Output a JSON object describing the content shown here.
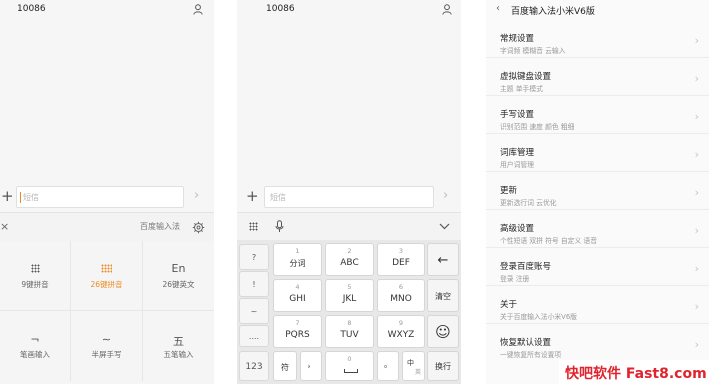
{
  "panel1": {
    "contact": "10086",
    "input_placeholder": "短信",
    "plus": "+",
    "send": "›",
    "close": "×",
    "ime_name": "百度输入法",
    "modes": [
      {
        "label": "9键拼音",
        "icon": "dot-grid-icon"
      },
      {
        "label": "26键拼音",
        "icon": "dot-grid-orange-icon"
      },
      {
        "label": "26键英文",
        "glyph": "En"
      },
      {
        "label": "笔画输入",
        "glyph": "¬"
      },
      {
        "label": "半屏手写",
        "glyph": "∼"
      },
      {
        "label": "五笔输入",
        "glyph": "五"
      }
    ]
  },
  "panel2": {
    "contact": "10086",
    "input_placeholder": "短信",
    "plus": "+",
    "send": "›",
    "left_keys": [
      "?",
      "!",
      "~",
      "....",
      "123"
    ],
    "keys": [
      {
        "num": "1",
        "letters": "分词"
      },
      {
        "num": "2",
        "letters": "ABC"
      },
      {
        "num": "3",
        "letters": "DEF"
      },
      {
        "num": "4",
        "letters": "GHI"
      },
      {
        "num": "5",
        "letters": "JKL"
      },
      {
        "num": "6",
        "letters": "MNO"
      },
      {
        "num": "7",
        "letters": "PQRS"
      },
      {
        "num": "8",
        "letters": "TUV"
      },
      {
        "num": "9",
        "letters": "WXYZ"
      }
    ],
    "right_keys": {
      "backspace": "←",
      "clear": "清空",
      "emoji": "☺",
      "enter": "换行"
    },
    "bottom": {
      "symbol": "符",
      "comma": "，",
      "space_num": "0",
      "period": "。",
      "lang_top": "中",
      "lang_bottom": "英"
    }
  },
  "panel3": {
    "title": "百度输入法小米V6版",
    "back": "‹",
    "items": [
      {
        "title": "常规设置",
        "subtitle": "字词频    模糊音    云输入"
      },
      {
        "title": "虚拟键盘设置",
        "subtitle": "主题    单手模式"
      },
      {
        "title": "手写设置",
        "subtitle": "识别范围    速度    颜色    粗细"
      },
      {
        "title": "词库管理",
        "subtitle": "用户词管理"
      },
      {
        "title": "更新",
        "subtitle": "更新选行词    云优化"
      },
      {
        "title": "高级设置",
        "subtitle": "个性短语    双拼    符号    自定义    语音"
      },
      {
        "title": "登录百度账号",
        "subtitle": "登录    注册"
      },
      {
        "title": "关于",
        "subtitle": "关于百度输入法小米V6版"
      },
      {
        "title": "恢复默认设置",
        "subtitle": "一键恢复所有设置项"
      }
    ],
    "chevron": "›"
  },
  "watermark": "快吧软件 Fast8.com",
  "colors": {
    "accent": "#f08a24",
    "watermark": "#e0242d"
  }
}
